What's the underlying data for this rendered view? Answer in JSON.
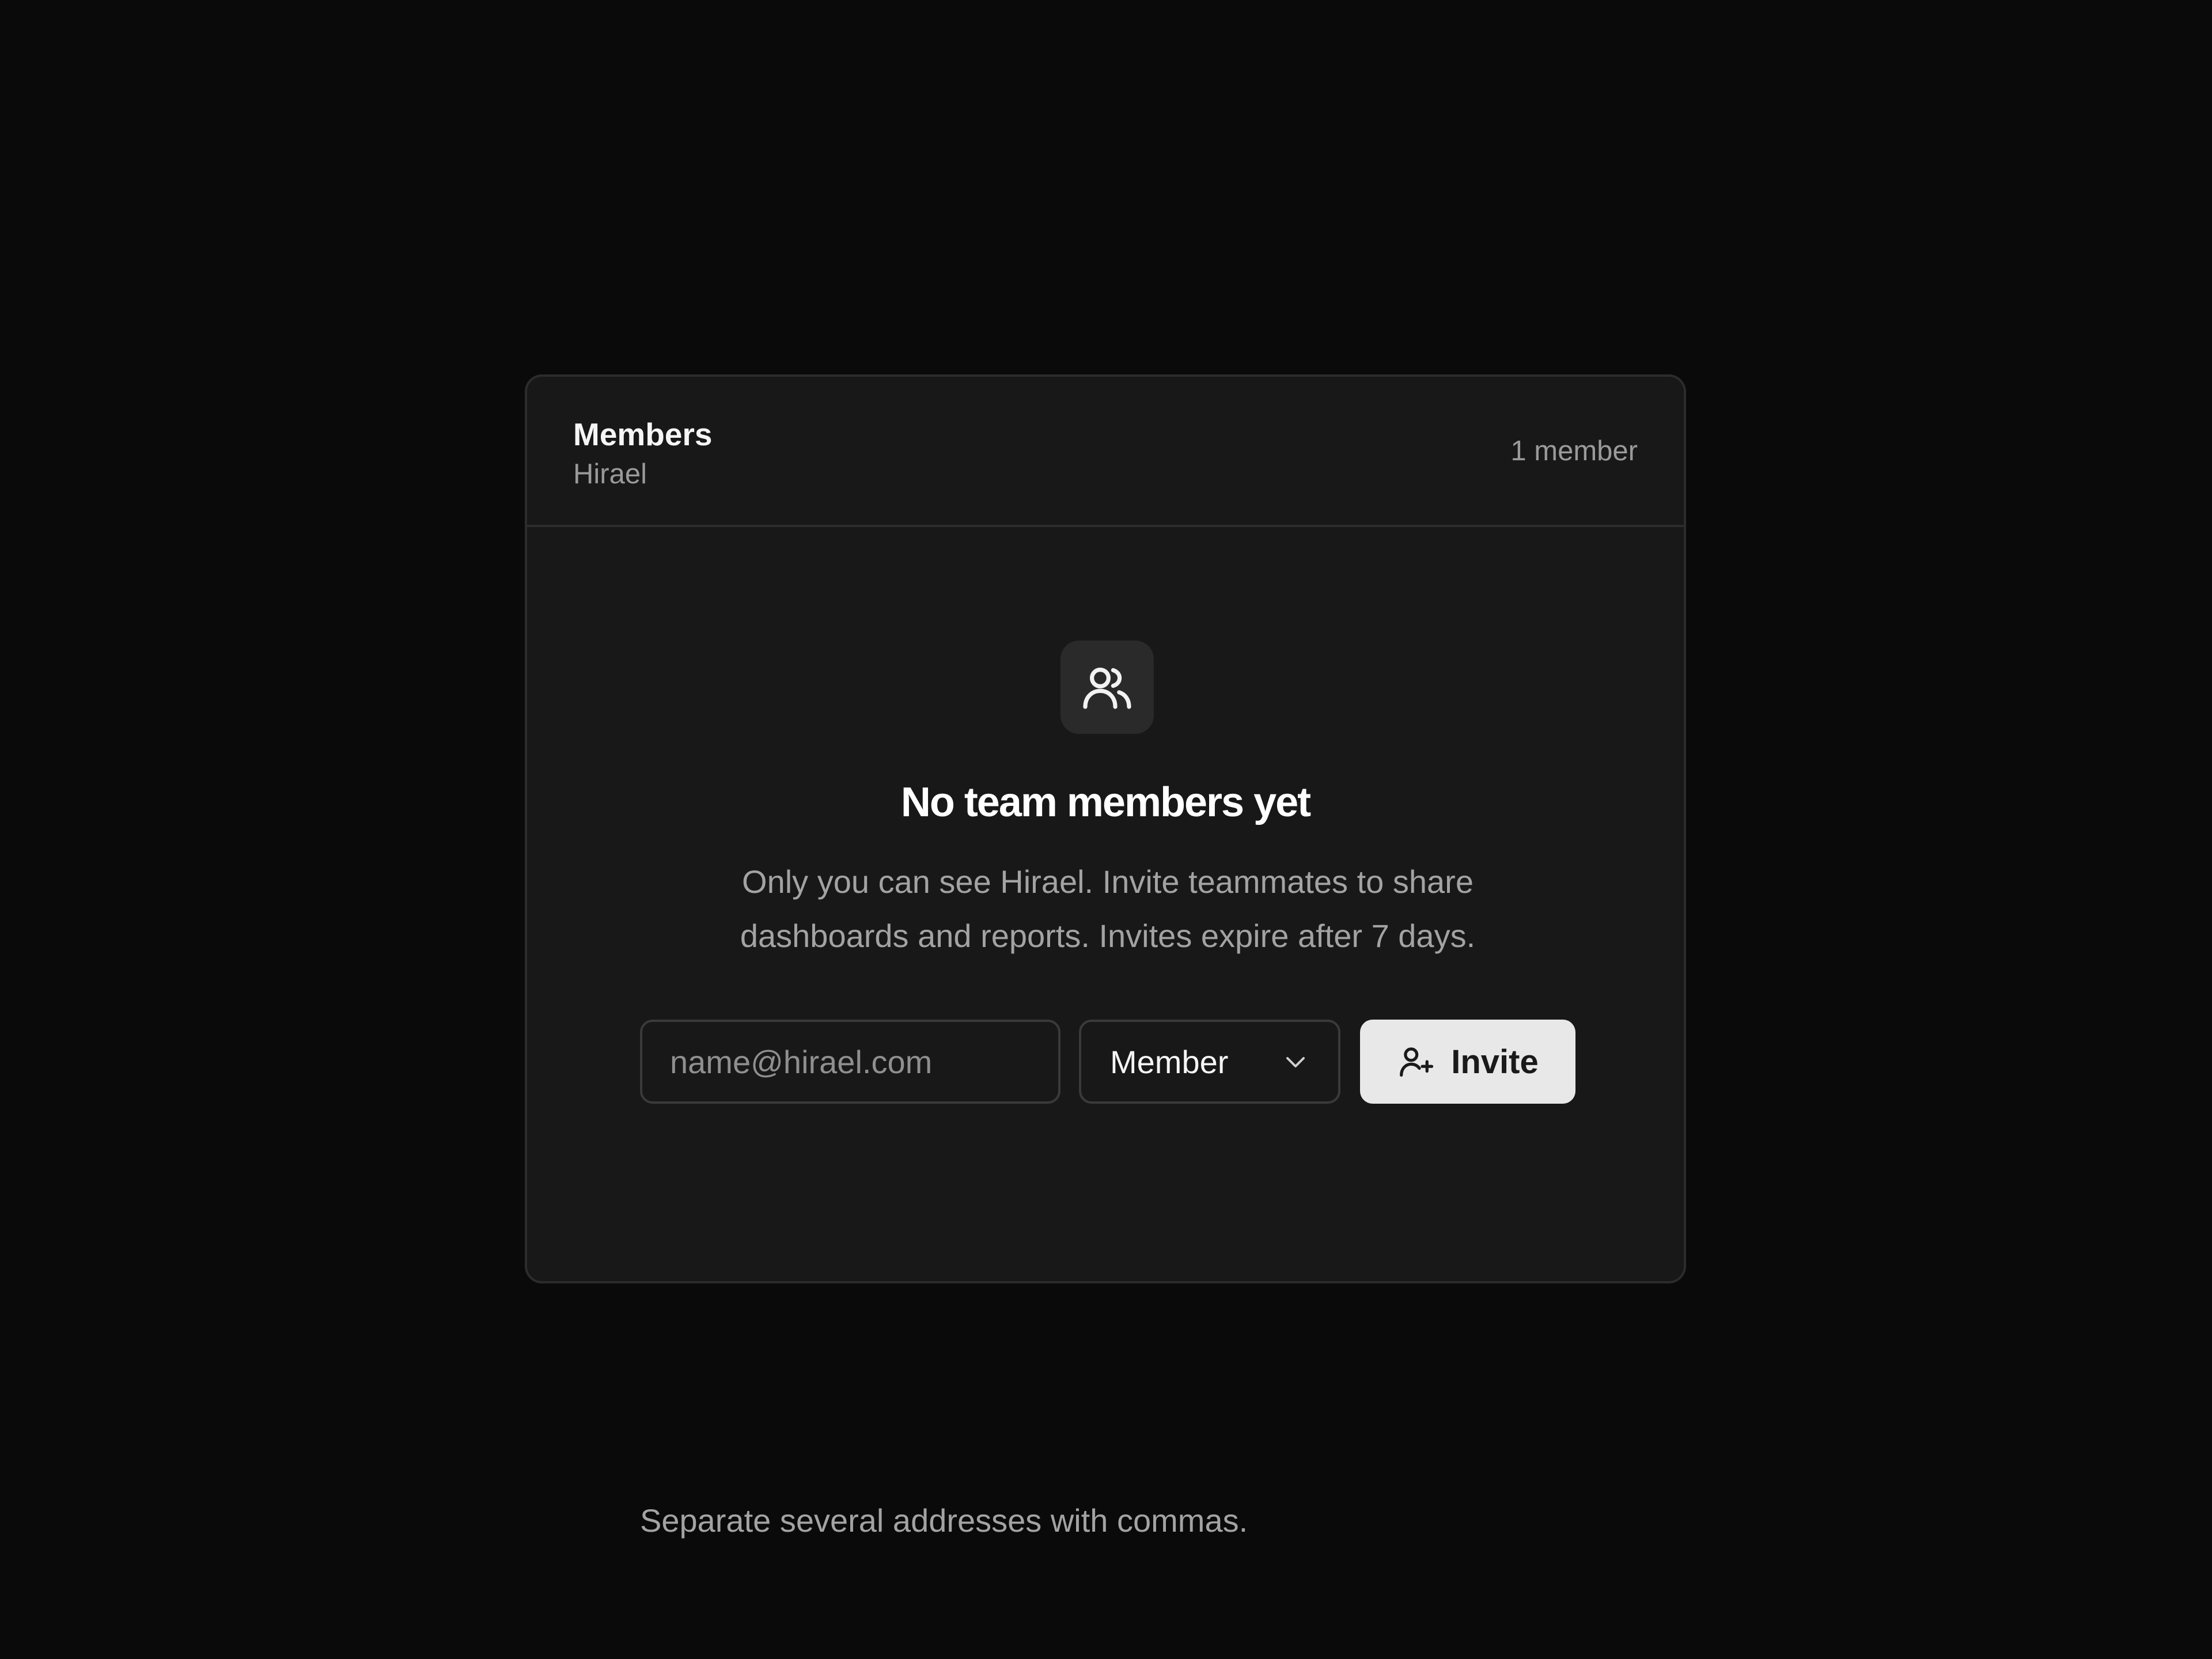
{
  "header": {
    "title": "Members",
    "subtitle": "Hirael",
    "member_count": "1 member"
  },
  "empty_state": {
    "icon": "users-icon",
    "title": "No team members yet",
    "description": "Only you can see Hirael. Invite teammates to share dashboards and reports. Invites expire after 7 days."
  },
  "invite_form": {
    "email_placeholder": "name@hirael.com",
    "email_value": "",
    "role_selected": "Member",
    "invite_label": "Invite",
    "invite_icon": "user-plus-icon",
    "helper_text": "Separate several addresses with commas."
  },
  "colors": {
    "background": "#0a0a0a",
    "card": "#181818",
    "border": "#2c2c2c",
    "primary_button": "#e8e8e8"
  }
}
